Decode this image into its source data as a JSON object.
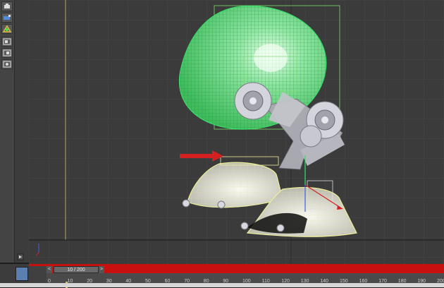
{
  "toolbar": {
    "tools": [
      "teapot-icon",
      "paint-icon",
      "gizmo-icon",
      "frame-icon",
      "frame-icon-2",
      "frame-icon-3"
    ]
  },
  "timeline": {
    "frame_indicator": "10 / 200",
    "prev_label": "<",
    "next_label": ">",
    "ticks": [
      "0",
      "10",
      "20",
      "30",
      "40",
      "50",
      "60",
      "70",
      "80",
      "90",
      "100",
      "110",
      "120",
      "130",
      "140",
      "150",
      "160",
      "170",
      "180",
      "190",
      "200"
    ]
  },
  "colors": {
    "viewport_bg": "#3b3b3b",
    "grid": "#474747",
    "selection": "#39e06b",
    "wire_yellow": "#f0ef9c",
    "red": "#c81010"
  }
}
